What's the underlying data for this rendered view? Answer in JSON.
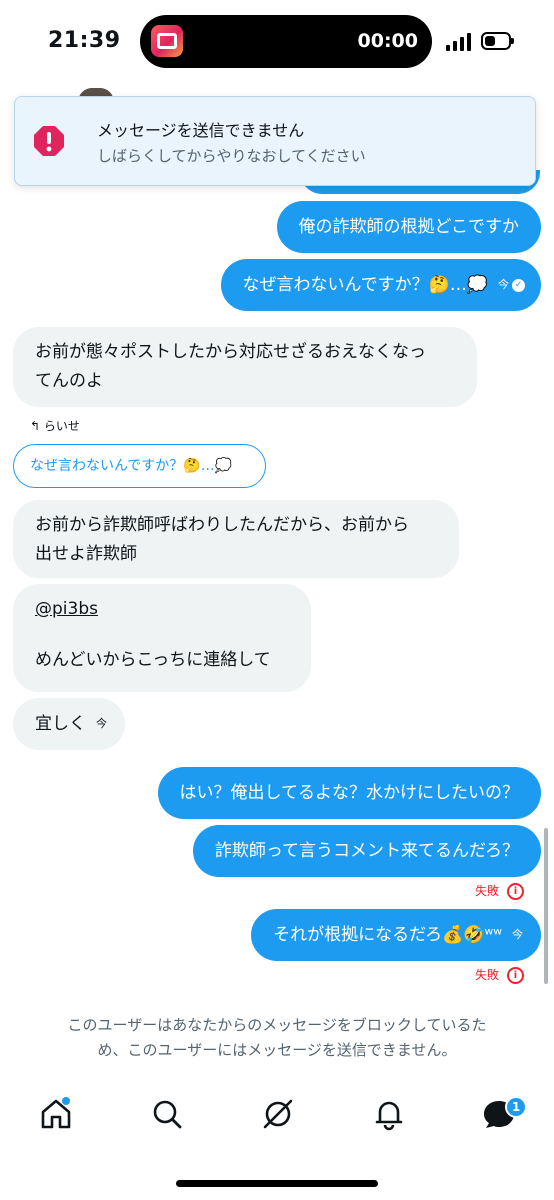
{
  "status": {
    "time": "21:39",
    "recording_time": "00:00"
  },
  "toast": {
    "title": "メッセージを送信できません",
    "subtitle": "しばらくしてからやりなおしてください",
    "icon": "error-octagon-icon",
    "color": "#e0245e"
  },
  "messages": [
    {
      "from": "me",
      "text": "俺の詐欺師の根拠どこですか"
    },
    {
      "from": "me",
      "text": "なぜ言わないんですか？🤔…💭",
      "time": "今",
      "read": true
    },
    {
      "from": "them",
      "lines": [
        "お前が態々ポストしたから対応せざるおえなくなっ",
        "てんのよ"
      ]
    },
    {
      "from": "them",
      "reply_label": "らいせ",
      "quote": "なぜ言わないんですか？🤔…💭"
    },
    {
      "from": "them",
      "lines": [
        "お前から詐欺師呼ばわりしたんだから、お前から",
        "出せよ詐欺師"
      ]
    },
    {
      "from": "them",
      "mention": "@pi3bs",
      "text": "めんどいからこっちに連絡して"
    },
    {
      "from": "them",
      "text": "宜しく",
      "time": "今"
    },
    {
      "from": "me",
      "text": "はい？俺出してるよな？水かけにしたいの？"
    },
    {
      "from": "me",
      "text": "詐欺師って言うコメント来てるんだろ？",
      "status": "失敗"
    },
    {
      "from": "me",
      "text": "それが根拠になるだろ💰🤣ʷʷ",
      "time": "今",
      "status": "失敗"
    }
  ],
  "block_notice": {
    "line1": "このユーザーはあなたからのメッセージをブロックしているた",
    "line2": "め、このユーザーにはメッセージを送信できません。"
  },
  "nav": {
    "items": [
      "home-icon",
      "search-icon",
      "grok-icon",
      "notifications-icon",
      "messages-icon"
    ],
    "messages_badge": "1"
  },
  "colors": {
    "accent": "#1d9bf0",
    "error": "#f4212e",
    "incoming": "#eff3f4"
  }
}
